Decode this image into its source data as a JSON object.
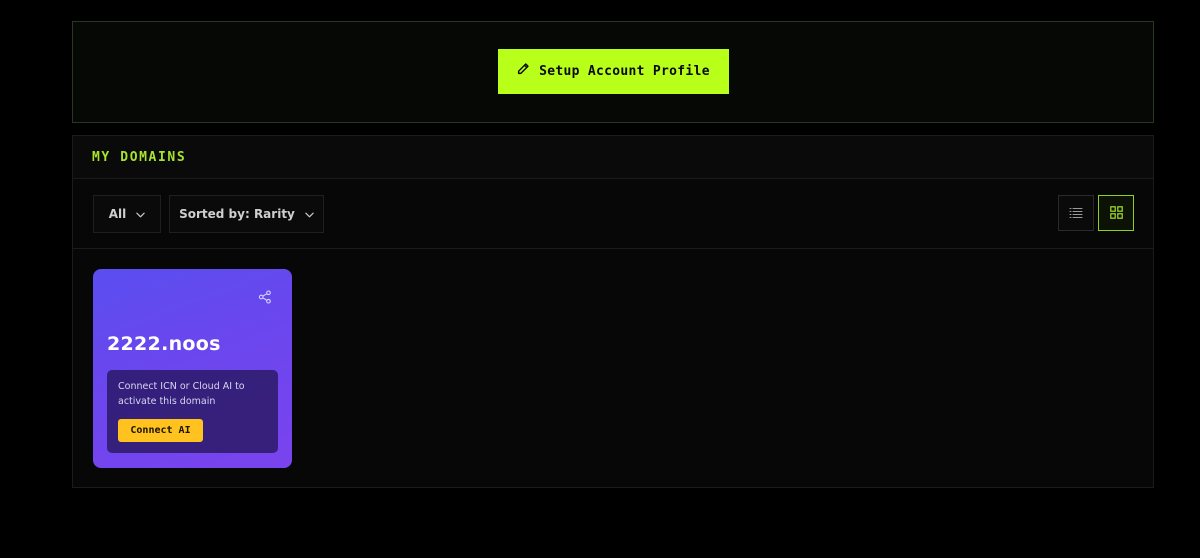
{
  "profile": {
    "setup_button_label": "Setup Account Profile",
    "setup_button_icon": "pencil-icon",
    "accent_color": "#b8ff1a"
  },
  "domains_section": {
    "title": "MY DOMAINS",
    "title_color": "#a6e22e",
    "filter": {
      "selected": "All",
      "icon": "chevron-down-icon"
    },
    "sort": {
      "selected": "Sorted by: Rarity",
      "icon": "chevron-down-icon"
    },
    "view_toggle": {
      "options": [
        "list-view-icon",
        "grid-view-icon"
      ],
      "active": "grid-view-icon"
    },
    "cards": [
      {
        "name": "2222.noos",
        "share_icon": "share-icon",
        "message": "Connect ICN or Cloud AI to activate this domain",
        "action_label": "Connect AI",
        "action_color": "#ffc21f"
      }
    ]
  }
}
